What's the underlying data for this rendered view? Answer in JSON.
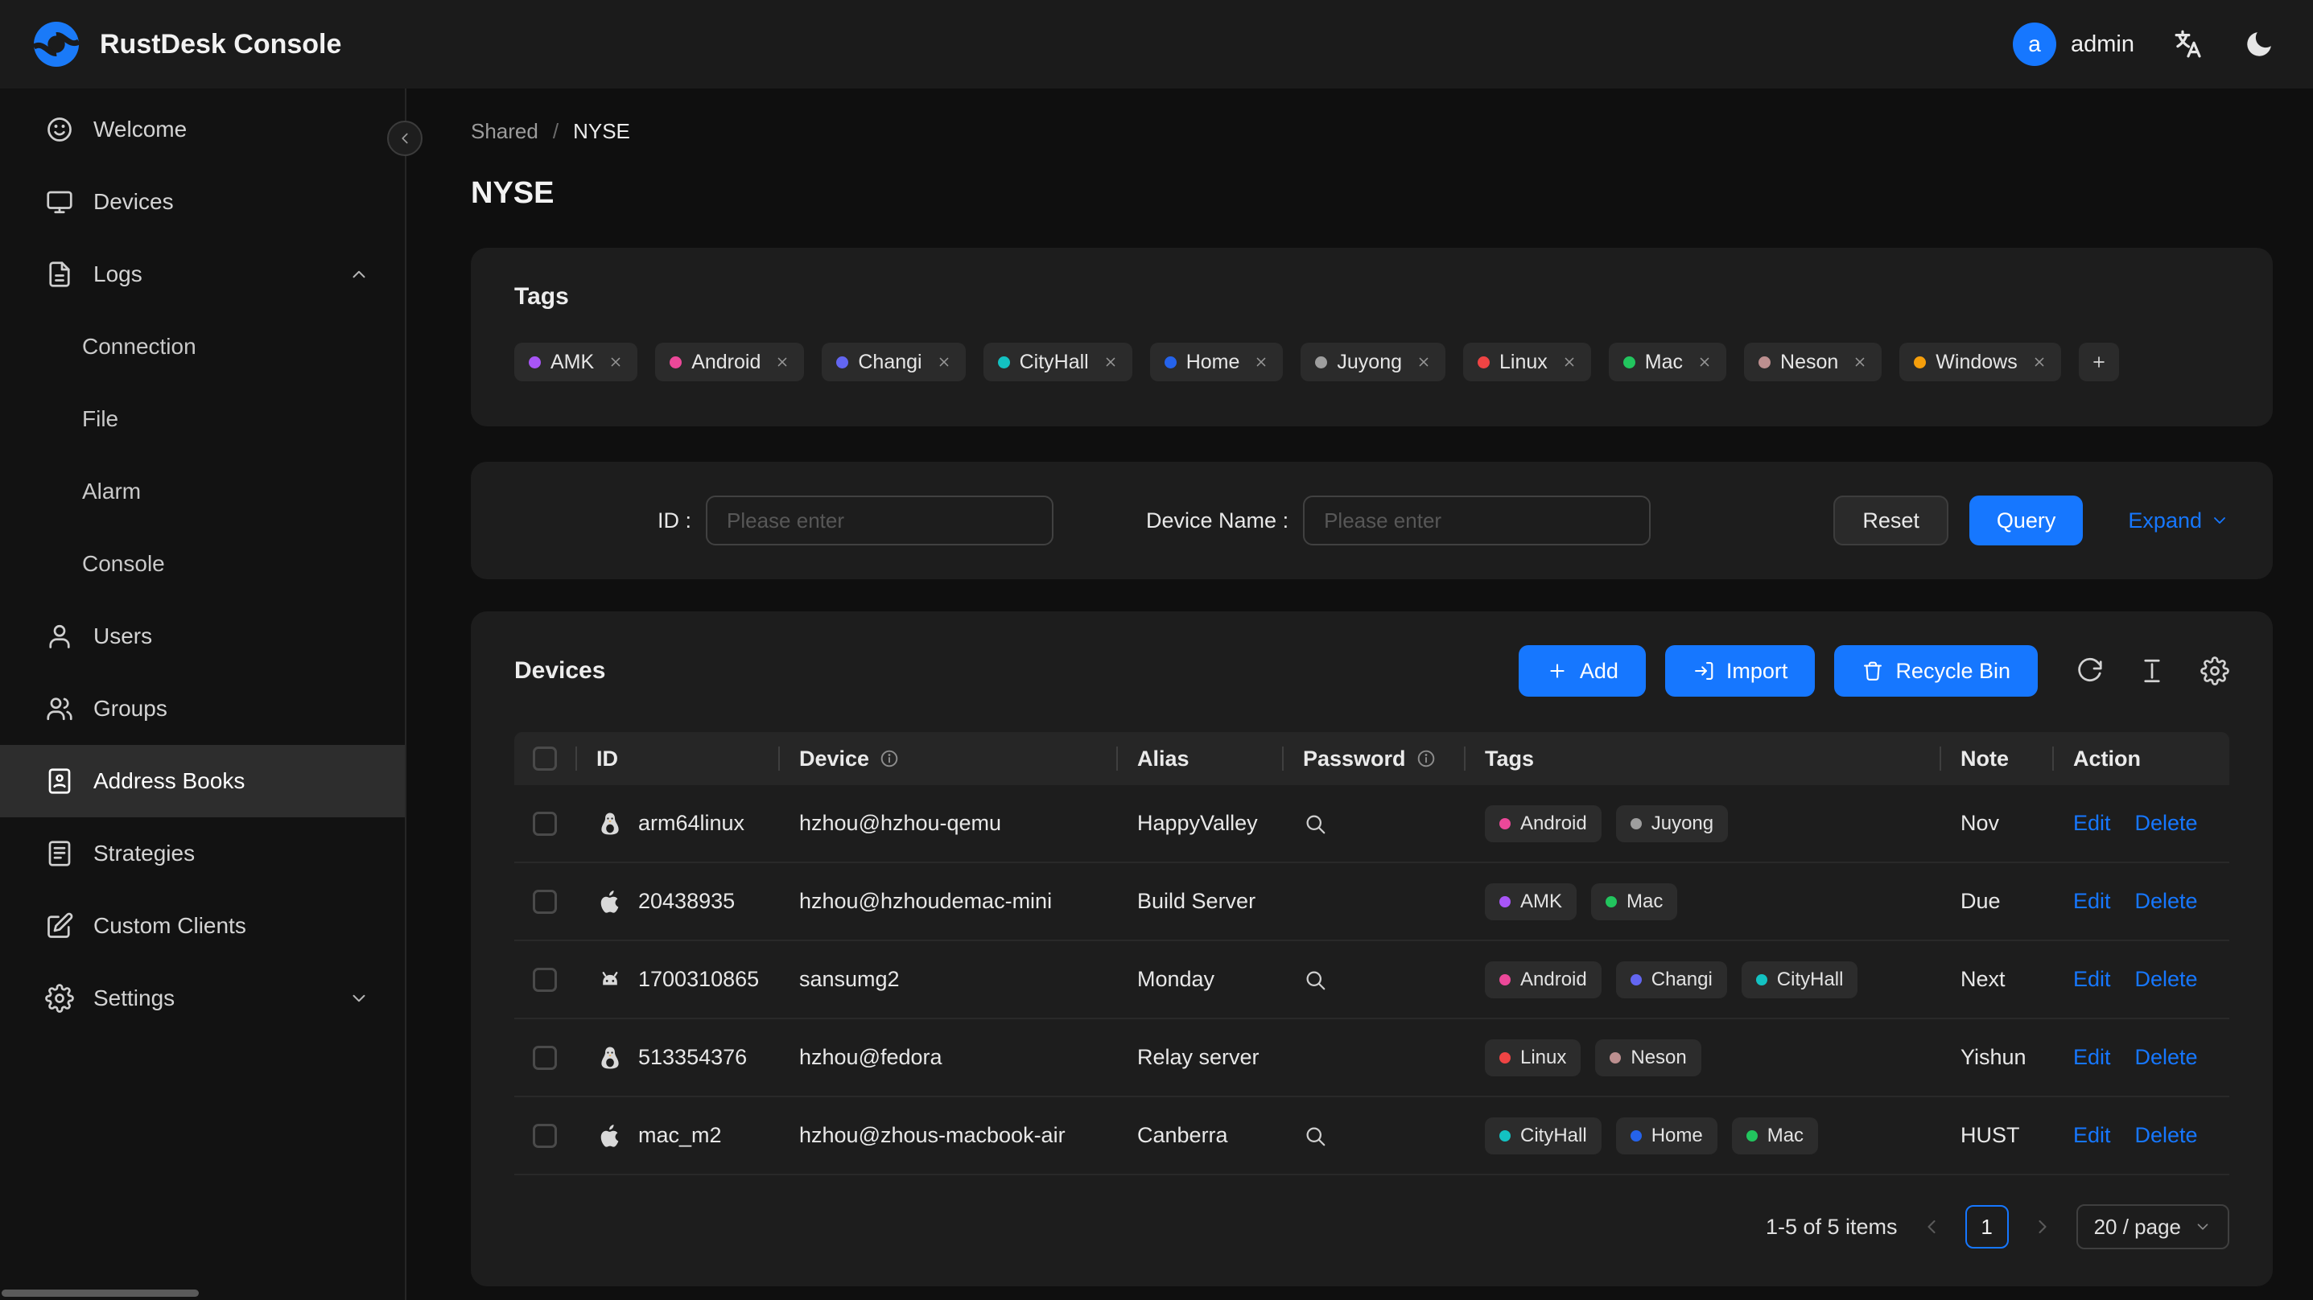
{
  "header": {
    "app_title": "RustDesk Console",
    "user": {
      "avatar_letter": "a",
      "name": "admin"
    },
    "icons": [
      "translate",
      "moon"
    ]
  },
  "sidebar": {
    "items": [
      {
        "label": "Welcome",
        "icon": "smile"
      },
      {
        "label": "Devices",
        "icon": "monitor"
      },
      {
        "label": "Logs",
        "icon": "file",
        "expanded": true,
        "children": [
          "Connection",
          "File",
          "Alarm",
          "Console"
        ]
      },
      {
        "label": "Users",
        "icon": "user"
      },
      {
        "label": "Groups",
        "icon": "users"
      },
      {
        "label": "Address Books",
        "icon": "address-book",
        "active": true
      },
      {
        "label": "Strategies",
        "icon": "strategy"
      },
      {
        "label": "Custom Clients",
        "icon": "edit-square"
      },
      {
        "label": "Settings",
        "icon": "gear",
        "expanded": false
      }
    ]
  },
  "breadcrumb": {
    "parent": "Shared",
    "separator": "/",
    "current": "NYSE"
  },
  "page_title": "NYSE",
  "tags_card": {
    "title": "Tags",
    "tags": [
      {
        "label": "AMK",
        "color": "#a855f7"
      },
      {
        "label": "Android",
        "color": "#ec4899"
      },
      {
        "label": "Changi",
        "color": "#6366f1"
      },
      {
        "label": "CityHall",
        "color": "#13c2c2"
      },
      {
        "label": "Home",
        "color": "#2563eb"
      },
      {
        "label": "Juyong",
        "color": "#9e9e9e"
      },
      {
        "label": "Linux",
        "color": "#ef4444"
      },
      {
        "label": "Mac",
        "color": "#22c55e"
      },
      {
        "label": "Neson",
        "color": "#bc8f8f"
      },
      {
        "label": "Windows",
        "color": "#f59e0b"
      }
    ]
  },
  "filter_card": {
    "id_label": "ID :",
    "id_placeholder": "Please enter",
    "device_name_label": "Device Name :",
    "device_name_placeholder": "Please enter",
    "reset_label": "Reset",
    "query_label": "Query",
    "expand_label": "Expand"
  },
  "devices_card": {
    "title": "Devices",
    "add_label": "Add",
    "import_label": "Import",
    "recycle_bin_label": "Recycle Bin",
    "tools": [
      {
        "icon": "refresh",
        "name": "refresh-icon"
      },
      {
        "icon": "column-height",
        "name": "column-height-icon"
      },
      {
        "icon": "gear",
        "name": "table-settings-icon"
      }
    ],
    "columns": {
      "id": "ID",
      "device": "Device",
      "alias": "Alias",
      "password": "Password",
      "tags": "Tags",
      "note": "Note",
      "action": "Action"
    },
    "action_edit": "Edit",
    "action_delete": "Delete",
    "rows": [
      {
        "os": "linux",
        "id": "arm64linux",
        "device": "hzhou@hzhou-qemu",
        "alias": "HappyValley",
        "password_search": true,
        "tags": [
          "Android",
          "Juyong"
        ],
        "note": "Nov"
      },
      {
        "os": "apple",
        "id": "20438935",
        "device": "hzhou@hzhoudemac-mini",
        "alias": "Build Server",
        "password_search": false,
        "tags": [
          "AMK",
          "Mac"
        ],
        "note": "Due"
      },
      {
        "os": "android",
        "id": "1700310865",
        "device": "sansumg2",
        "alias": "Monday",
        "password_search": true,
        "tags": [
          "Android",
          "Changi",
          "CityHall"
        ],
        "note": "Next"
      },
      {
        "os": "linux",
        "id": "513354376",
        "device": "hzhou@fedora",
        "alias": "Relay server",
        "password_search": false,
        "tags": [
          "Linux",
          "Neson"
        ],
        "note": "Yishun"
      },
      {
        "os": "apple",
        "id": "mac_m2",
        "device": "hzhou@zhous-macbook-air",
        "alias": "Canberra",
        "password_search": true,
        "tags": [
          "CityHall",
          "Home",
          "Mac"
        ],
        "note": "HUST"
      }
    ],
    "pagination": {
      "summary": "1-5 of 5 items",
      "current_page": "1",
      "page_size": "20 / page"
    }
  },
  "colors": {
    "accent": "#1677ff"
  }
}
